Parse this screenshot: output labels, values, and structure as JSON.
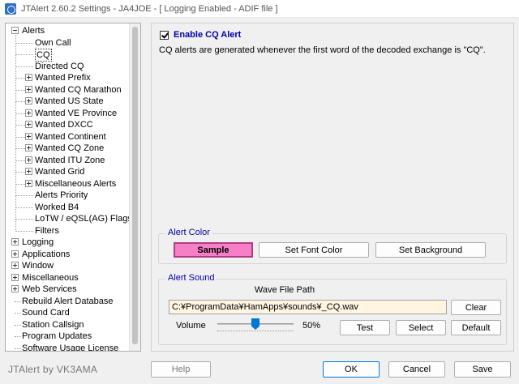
{
  "window": {
    "title": "JTAlert 2.60.2 Settings  -  JA4JOE  -  [ Logging Enabled - ADIF file ]"
  },
  "tree": {
    "items": [
      {
        "label": "Alerts",
        "level": 0,
        "expander": "minus"
      },
      {
        "label": "Own Call",
        "level": 1,
        "expander": "none"
      },
      {
        "label": "CQ",
        "level": 1,
        "expander": "none",
        "selected": true
      },
      {
        "label": "Directed CQ",
        "level": 1,
        "expander": "none"
      },
      {
        "label": "Wanted Prefix",
        "level": 1,
        "expander": "plus"
      },
      {
        "label": "Wanted CQ Marathon",
        "level": 1,
        "expander": "plus"
      },
      {
        "label": "Wanted US State",
        "level": 1,
        "expander": "plus"
      },
      {
        "label": "Wanted VE Province",
        "level": 1,
        "expander": "plus"
      },
      {
        "label": "Wanted DXCC",
        "level": 1,
        "expander": "plus"
      },
      {
        "label": "Wanted Continent",
        "level": 1,
        "expander": "plus"
      },
      {
        "label": "Wanted CQ Zone",
        "level": 1,
        "expander": "plus"
      },
      {
        "label": "Wanted ITU Zone",
        "level": 1,
        "expander": "plus"
      },
      {
        "label": "Wanted Grid",
        "level": 1,
        "expander": "plus"
      },
      {
        "label": "Miscellaneous Alerts",
        "level": 1,
        "expander": "plus"
      },
      {
        "label": "Alerts Priority",
        "level": 1,
        "expander": "none"
      },
      {
        "label": "Worked B4",
        "level": 1,
        "expander": "none"
      },
      {
        "label": "LoTW / eQSL(AG) Flags",
        "level": 1,
        "expander": "none"
      },
      {
        "label": "Filters",
        "level": 1,
        "expander": "none"
      },
      {
        "label": "Logging",
        "level": 0,
        "expander": "plus"
      },
      {
        "label": "Applications",
        "level": 0,
        "expander": "plus"
      },
      {
        "label": "Window",
        "level": 0,
        "expander": "plus"
      },
      {
        "label": "Miscellaneous",
        "level": 0,
        "expander": "plus"
      },
      {
        "label": "Web Services",
        "level": 0,
        "expander": "plus"
      },
      {
        "label": "Rebuild Alert Database",
        "level": 0,
        "expander": "none"
      },
      {
        "label": "Sound Card",
        "level": 0,
        "expander": "none"
      },
      {
        "label": "Station Callsign",
        "level": 0,
        "expander": "none"
      },
      {
        "label": "Program Updates",
        "level": 0,
        "expander": "none"
      },
      {
        "label": "Software Usage License",
        "level": 0,
        "expander": "none"
      }
    ]
  },
  "main": {
    "enable_label": "Enable CQ Alert",
    "enable_checked": true,
    "description": "CQ alerts are generated whenever the first word of the decoded exchange is \"CQ\".",
    "alert_color": {
      "legend": "Alert Color",
      "sample_label": "Sample",
      "sample_color": "#f77fc6",
      "font_button": "Set Font Color",
      "background_button": "Set Background"
    },
    "alert_sound": {
      "legend": "Alert Sound",
      "path_label": "Wave File Path",
      "path_value": "C:¥ProgramData¥HamApps¥sounds¥_CQ.wav",
      "clear_button": "Clear",
      "volume_label": "Volume",
      "volume_value": 50,
      "volume_text": "50%",
      "test_button": "Test",
      "select_button": "Select",
      "default_button": "Default"
    }
  },
  "footer": {
    "brand": "JTAlert by VK3AMA",
    "help_button": "Help",
    "ok_button": "OK",
    "cancel_button": "Cancel",
    "save_button": "Save"
  },
  "colors": {
    "accent": "#0000aa",
    "slider": "#0078d7"
  }
}
